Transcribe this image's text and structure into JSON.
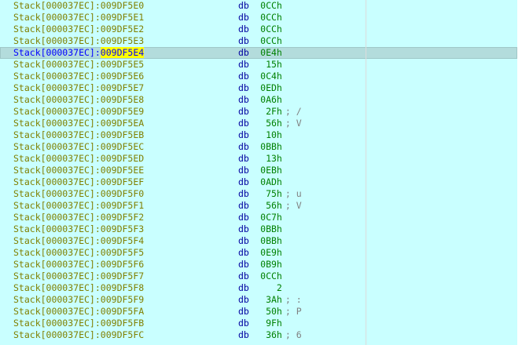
{
  "listing": {
    "segment": "Stack[000037EC]",
    "mnemonic": "db",
    "selected_index": 4,
    "rows": [
      {
        "offset": "009DF5E0",
        "value": "0CCh",
        "comment": ""
      },
      {
        "offset": "009DF5E1",
        "value": "0CCh",
        "comment": ""
      },
      {
        "offset": "009DF5E2",
        "value": "0CCh",
        "comment": ""
      },
      {
        "offset": "009DF5E3",
        "value": "0CCh",
        "comment": ""
      },
      {
        "offset": "009DF5E4",
        "value": "0E4h",
        "comment": ""
      },
      {
        "offset": "009DF5E5",
        "value": "15h",
        "comment": ""
      },
      {
        "offset": "009DF5E6",
        "value": "0C4h",
        "comment": ""
      },
      {
        "offset": "009DF5E7",
        "value": "0EDh",
        "comment": ""
      },
      {
        "offset": "009DF5E8",
        "value": "0A6h",
        "comment": ""
      },
      {
        "offset": "009DF5E9",
        "value": "2Fh",
        "comment": "; /"
      },
      {
        "offset": "009DF5EA",
        "value": "56h",
        "comment": "; V"
      },
      {
        "offset": "009DF5EB",
        "value": "10h",
        "comment": ""
      },
      {
        "offset": "009DF5EC",
        "value": "0BBh",
        "comment": ""
      },
      {
        "offset": "009DF5ED",
        "value": "13h",
        "comment": ""
      },
      {
        "offset": "009DF5EE",
        "value": "0EBh",
        "comment": ""
      },
      {
        "offset": "009DF5EF",
        "value": "0ADh",
        "comment": ""
      },
      {
        "offset": "009DF5F0",
        "value": "75h",
        "comment": "; u"
      },
      {
        "offset": "009DF5F1",
        "value": "56h",
        "comment": "; V"
      },
      {
        "offset": "009DF5F2",
        "value": "0C7h",
        "comment": ""
      },
      {
        "offset": "009DF5F3",
        "value": "0BBh",
        "comment": ""
      },
      {
        "offset": "009DF5F4",
        "value": "0BBh",
        "comment": ""
      },
      {
        "offset": "009DF5F5",
        "value": "0E9h",
        "comment": ""
      },
      {
        "offset": "009DF5F6",
        "value": "0B9h",
        "comment": ""
      },
      {
        "offset": "009DF5F7",
        "value": "0CCh",
        "comment": ""
      },
      {
        "offset": "009DF5F8",
        "value": "2",
        "comment": ""
      },
      {
        "offset": "009DF5F9",
        "value": "3Ah",
        "comment": "; :"
      },
      {
        "offset": "009DF5FA",
        "value": "50h",
        "comment": "; P"
      },
      {
        "offset": "009DF5FB",
        "value": "9Fh",
        "comment": ""
      },
      {
        "offset": "009DF5FC",
        "value": "36h",
        "comment": "; 6"
      }
    ]
  },
  "colors": {
    "background": "#c9ffff",
    "address": "#808000",
    "selected_address": "#0000ff",
    "highlight": "#ffff00",
    "mnemonic": "#0000a0",
    "value": "#008000",
    "comment": "#808080"
  }
}
